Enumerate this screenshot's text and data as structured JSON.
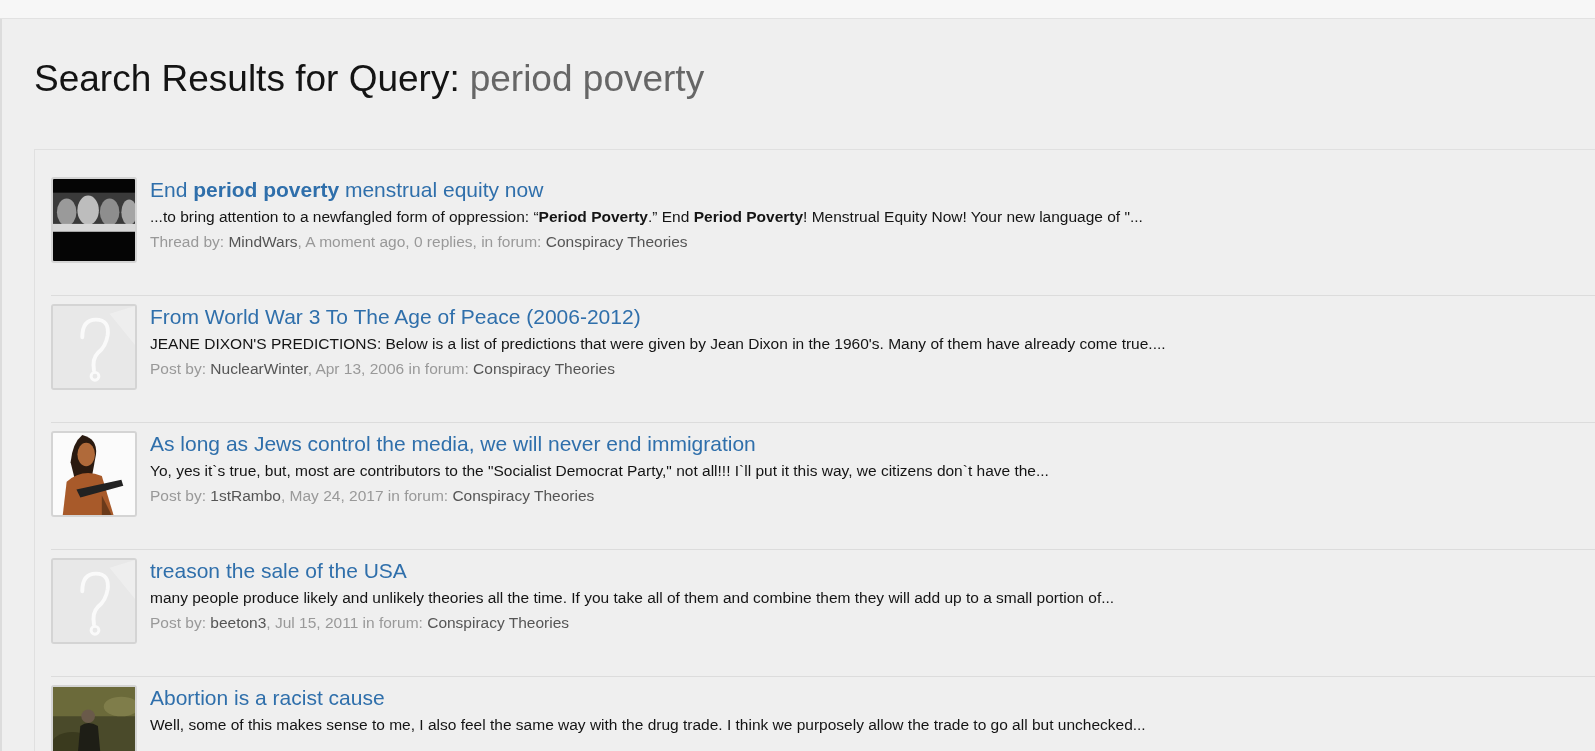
{
  "heading": {
    "label": "Search Results for Query:",
    "query": "period poverty"
  },
  "results": [
    {
      "title": "End **period poverty** menstrual equity now",
      "snippet": "...to bring attention to a newfangled form of oppression: “**Period Poverty**.” End **Period Poverty**! Menstrual Equity Now! Your new language of \"...",
      "meta": {
        "prefix": "Thread by:",
        "author": "MindWars",
        "details": ", A moment ago, 0 replies, in forum:",
        "forum": "Conspiracy Theories"
      }
    },
    {
      "avatar": {
        "kind": "placeholder"
      },
      "title": "From World War 3 To The Age of Peace (2006-2012)",
      "snippet": "JEANE DIXON'S PREDICTIONS: Below is a list of predictions that were given by Jean Dixon in the 1960's. Many of them have already come true....",
      "meta": {
        "prefix": "Post by:",
        "author": "NuclearWinter",
        "details": ", Apr 13, 2006 in forum:",
        "forum": "Conspiracy Theories"
      }
    },
    {
      "title": "As long as Jews control the media, we will never end immigration",
      "snippet": "Yo, yes it`s true, but, most are contributors to the \"Socialist Democrat Party,\" not all!!! I`ll put it this way, we citizens don`t have the...",
      "meta": {
        "prefix": "Post by:",
        "author": "1stRambo",
        "details": ", May 24, 2017 in forum:",
        "forum": "Conspiracy Theories"
      }
    },
    {
      "avatar": {
        "kind": "placeholder"
      },
      "title": "treason the sale of the USA",
      "snippet": "many people produce likely and unlikely theories all the time. If you take all of them and combine them they will add up to a small portion of...",
      "meta": {
        "prefix": "Post by:",
        "author": "beeton3",
        "details": ", Jul 15, 2011 in forum:",
        "forum": "Conspiracy Theories"
      }
    },
    {
      "title": "Abortion is a racist cause",
      "snippet": "Well, some of this makes sense to me, I also feel the same way with the drug trade. I think we purposely allow the trade to go all but unchecked..."
    }
  ]
}
